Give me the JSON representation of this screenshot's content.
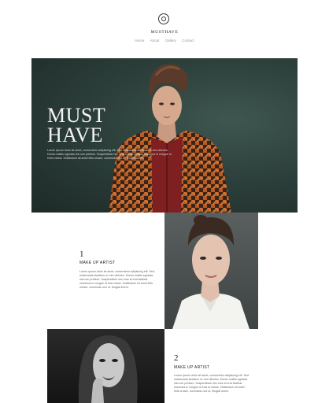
{
  "header": {
    "logo_icon": "circle-logo-icon",
    "brand": "MUSTHAVE",
    "nav": [
      "Home",
      "About",
      "Gallery",
      "Contact"
    ]
  },
  "hero": {
    "title_line1": "MUST",
    "title_line2": "HAVE",
    "text": "Lorem ipsum dolor sit amet, consectetur adipiscing elit. Sed malesuada faucibus ex nec ultricies. Donec mattis egestas nisi non pretium. Suspendisse nec eros id erat facilisis maximus in congue ut enim varius. Vestibulum sit amet felis ornare, commodo orci ut, feugiat lorem."
  },
  "sections": [
    {
      "number": "1",
      "title": "MAKE UP ARTIST",
      "text": "Lorem ipsum dolor sit amet, consectetur adipiscing elit. Sed malesuada faucibus ex nec ultricies. Donec mattis egestas nisi non pretium. Suspendisse nec eros id erat facilisis maximus in congue id erat varius. Vestibulum sit amet felis ornare, commodo orci ut, feugiat lorem."
    },
    {
      "number": "2",
      "title": "MAKE UP ARTIST",
      "text": "Lorem ipsum dolor sit amet, consectetur adipiscing elit. Sed malesuada faucibus ex nec ultricies. Donec mattis egestas nisi non pretium. Suspendisse nec eros id erat facilisis maximus in congue id erat ut varius. Vestibulum sit amet felis ornare, commodo orci ut, feugiat lorem."
    }
  ],
  "colors": {
    "hero_bg": "#2d403c",
    "text_dark": "#222222",
    "text_muted": "#999999"
  }
}
